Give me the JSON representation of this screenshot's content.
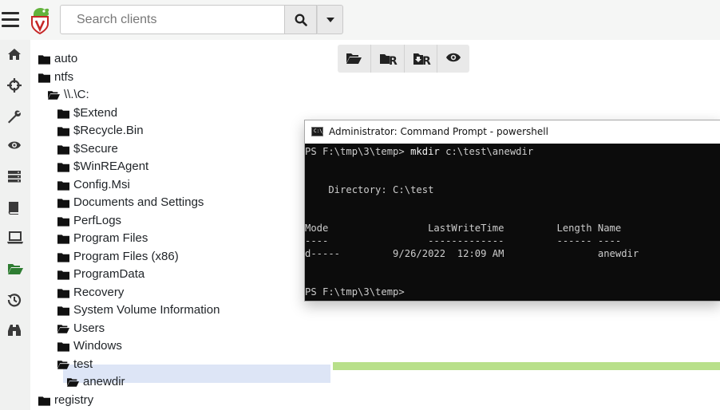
{
  "header": {
    "search": {
      "placeholder": "Search clients",
      "value": ""
    }
  },
  "sidebar": {
    "icons": [
      "home-icon",
      "crosshairs-icon",
      "wrench-icon",
      "eye-icon",
      "server-icon",
      "book-icon",
      "laptop-icon",
      "folder-open-icon",
      "history-icon",
      "binoculars-icon"
    ],
    "active_index": 7
  },
  "tree": {
    "nodes": [
      {
        "label": "auto",
        "icon": "folder-icon"
      },
      {
        "label": "ntfs",
        "icon": "folder-icon"
      },
      {
        "label": "\\\\.\\C:",
        "icon": "folder-open-icon"
      },
      {
        "label": "$Extend",
        "icon": "folder-icon"
      },
      {
        "label": "$Recycle.Bin",
        "icon": "folder-icon"
      },
      {
        "label": "$Secure",
        "icon": "folder-icon"
      },
      {
        "label": "$WinREAgent",
        "icon": "folder-icon"
      },
      {
        "label": "Config.Msi",
        "icon": "folder-icon"
      },
      {
        "label": "Documents and Settings",
        "icon": "folder-icon"
      },
      {
        "label": "PerfLogs",
        "icon": "folder-icon"
      },
      {
        "label": "Program Files",
        "icon": "folder-icon"
      },
      {
        "label": "Program Files (x86)",
        "icon": "folder-icon"
      },
      {
        "label": "ProgramData",
        "icon": "folder-icon"
      },
      {
        "label": "Recovery",
        "icon": "folder-icon"
      },
      {
        "label": "System Volume Information",
        "icon": "folder-icon"
      },
      {
        "label": "Users",
        "icon": "folder-open-icon"
      },
      {
        "label": "Windows",
        "icon": "folder-icon"
      },
      {
        "label": "test",
        "icon": "folder-open-icon"
      },
      {
        "label": "anewdir",
        "icon": "folder-open-icon"
      },
      {
        "label": "registry",
        "icon": "folder-icon"
      }
    ],
    "selected": "anewdir"
  },
  "toolbar": {
    "buttons": [
      {
        "icon": "folder-open-icon"
      },
      {
        "icon": "folder-refresh-icon",
        "text": "R"
      },
      {
        "icon": "download-recursive-icon",
        "text": "R"
      },
      {
        "icon": "eye-icon"
      }
    ]
  },
  "terminal": {
    "title": "Administrator: Command Prompt - powershell",
    "icon_text": "C:\\_",
    "lines": [
      {
        "prompt": "PS F:\\tmp\\3\\temp> ",
        "command": "mkdir",
        "args": " c:\\test\\anewdir"
      },
      {
        "text": ""
      },
      {
        "text": ""
      },
      {
        "text": "    Directory: C:\\test"
      },
      {
        "text": ""
      },
      {
        "text": ""
      },
      {
        "text": "Mode                 LastWriteTime         Length Name"
      },
      {
        "text": "----                 -------------         ------ ----"
      },
      {
        "text": "d-----         9/26/2022  12:09 AM                anewdir"
      },
      {
        "text": ""
      },
      {
        "text": ""
      },
      {
        "text": "PS F:\\tmp\\3\\temp>"
      }
    ]
  },
  "colors": {
    "selected_row": "#dde5f6",
    "progress_bar": "#b8e08a",
    "active_nav": "#2e7d32",
    "terminal_bg": "#0c0c0c"
  }
}
